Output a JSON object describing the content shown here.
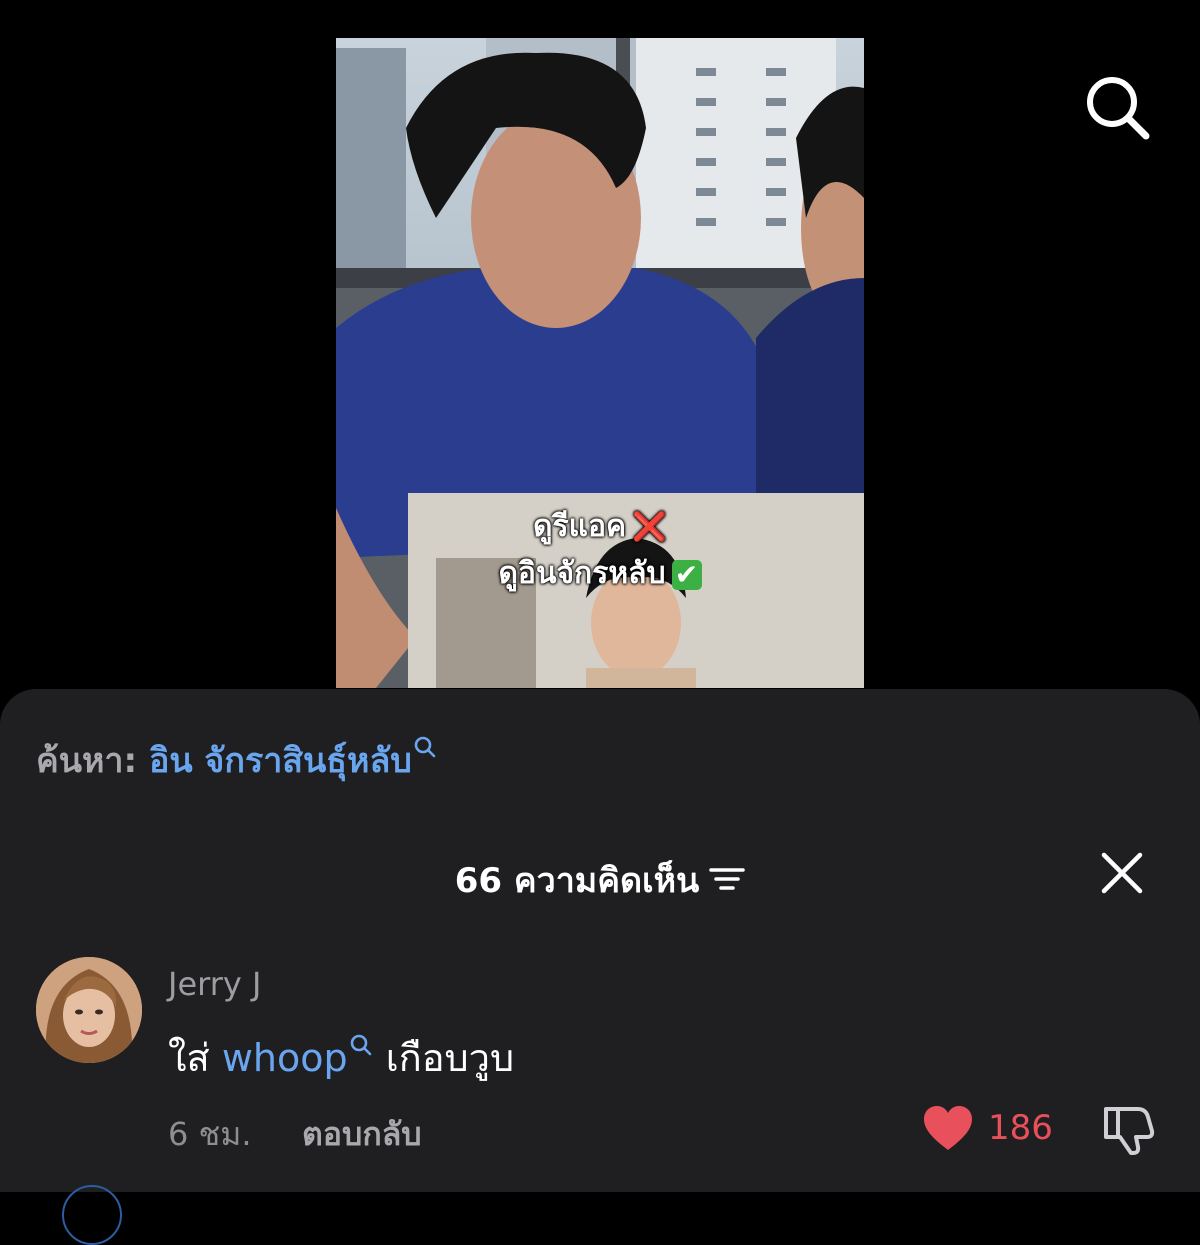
{
  "video": {
    "overlay_line1": "ดูรีแอค",
    "overlay_line1_mark": "❌",
    "overlay_line2": "ดูอินจักรหลับ",
    "overlay_line2_mark": "✔",
    "icons": {
      "search": "search-icon"
    }
  },
  "search_suggestion": {
    "prefix": "ค้นหา:",
    "query": "อิน จักราสินธุ์หลับ"
  },
  "comments": {
    "header": "66 ความคิดเห็น",
    "items": [
      {
        "username": "Jerry J",
        "text_before": "ใส่",
        "link": "whoop",
        "text_after": "เกือบวูบ",
        "time": "6 ชม.",
        "reply_label": "ตอบกลับ",
        "likes": "186"
      }
    ]
  },
  "colors": {
    "sheet_bg": "#1f1f21",
    "link": "#6aa6f0",
    "like": "#e8505b"
  }
}
